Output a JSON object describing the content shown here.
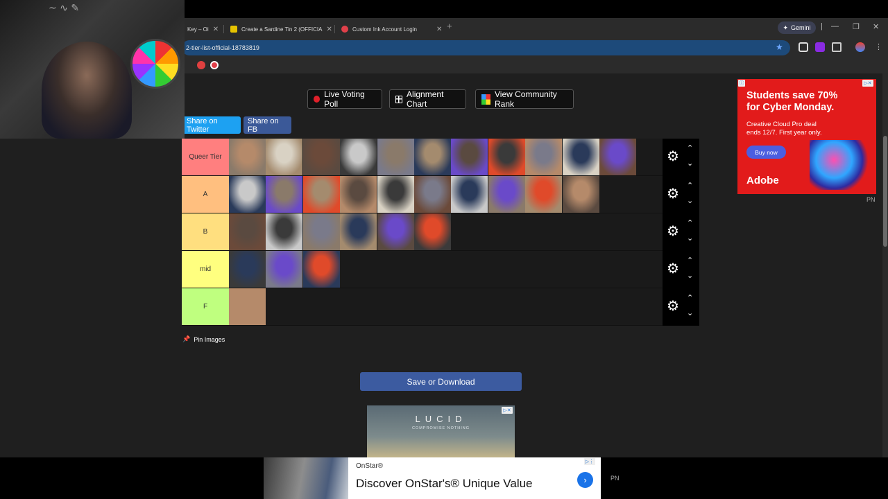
{
  "browser": {
    "tabs": [
      {
        "label": "Key – Oi",
        "close": "✕"
      },
      {
        "label": "Create a Sardine Tin 2 (OFFICIA",
        "close": "✕"
      },
      {
        "label": "Custom Ink Account Login",
        "close": "✕"
      }
    ],
    "new_tab": "+",
    "gemini_label": "Gemini",
    "url": "2-tier-list-official-18783819"
  },
  "toolbar": {
    "live_voting": "Live Voting Poll",
    "alignment_chart": "Alignment Chart",
    "community_rank": "View Community Rank"
  },
  "share": {
    "twitter": "Share on Twitter",
    "fb": "Share on FB"
  },
  "tiers": [
    {
      "label": "Queer Tier",
      "color": "#ff7f7f",
      "count": 11
    },
    {
      "label": "A",
      "color": "#ffbf7f",
      "count": 10
    },
    {
      "label": "B",
      "color": "#ffdf7f",
      "count": 6
    },
    {
      "label": "mid",
      "color": "#ffff7f",
      "count": 3
    },
    {
      "label": "F",
      "color": "#bfff7f",
      "count": 1
    }
  ],
  "pin_images": "Pin Images",
  "save_button": "Save or Download",
  "ads": {
    "adobe": {
      "headline": "Students save 70% for Cyber Monday.",
      "body": "Creative Cloud Pro deal ends 12/7. First year only.",
      "cta": "Buy now",
      "brand": "Adobe"
    },
    "lucid": {
      "logo": "LUCID",
      "tagline": "COMPROMISE NOTHING"
    },
    "onstar": {
      "brand": "OnStar®",
      "title": "Discover OnStar's® Unique Value",
      "cta": "›"
    },
    "pn_label": "PN"
  }
}
